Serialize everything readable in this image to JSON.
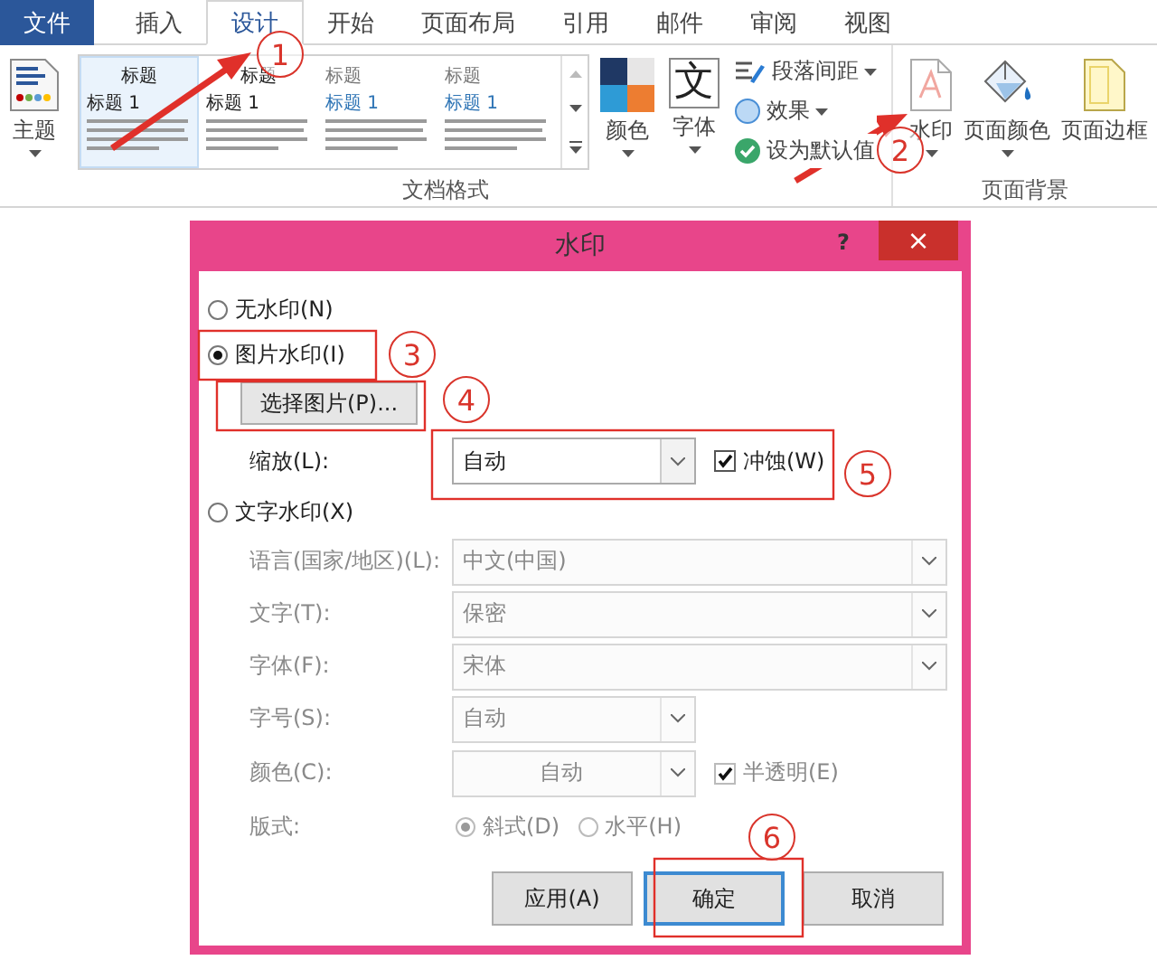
{
  "ribbon": {
    "tabs": [
      {
        "label": "文件",
        "kind": "file",
        "selected": false
      },
      {
        "label": "插入",
        "kind": "tab",
        "selected": false
      },
      {
        "label": "设计",
        "kind": "tab",
        "selected": true
      },
      {
        "label": "开始",
        "kind": "tab",
        "selected": false
      },
      {
        "label": "页面布局",
        "kind": "tab",
        "selected": false
      },
      {
        "label": "引用",
        "kind": "tab",
        "selected": false
      },
      {
        "label": "邮件",
        "kind": "tab",
        "selected": false
      },
      {
        "label": "审阅",
        "kind": "tab",
        "selected": false
      },
      {
        "label": "视图",
        "kind": "tab",
        "selected": false
      }
    ],
    "document_format": {
      "label": "文档格式",
      "theme_button": "主题",
      "gallery": [
        {
          "title": "标题",
          "heading": "标题 1",
          "kind": "centered",
          "selected": true
        },
        {
          "title": "标题",
          "heading": "标题 1",
          "kind": "centered",
          "selected": false
        },
        {
          "title": "标题",
          "heading": "标题 1",
          "kind": "light",
          "selected": false
        },
        {
          "title": "标题",
          "heading": "标题 1",
          "kind": "light",
          "selected": false
        }
      ],
      "colors_button": "颜色",
      "fonts_glyph": "文",
      "fonts_button": "字体",
      "small_buttons": [
        {
          "label": "段落间距",
          "kind": "spacing",
          "dropdown": true
        },
        {
          "label": "效果",
          "kind": "effects",
          "dropdown": true
        },
        {
          "label": "设为默认值",
          "kind": "default",
          "dropdown": false
        }
      ]
    },
    "page_background": {
      "label": "页面背景",
      "buttons": [
        {
          "label": "水印",
          "kind": "watermark",
          "dropdown": true
        },
        {
          "label": "页面颜色",
          "kind": "page-color",
          "dropdown": true
        },
        {
          "label": "页面边框",
          "kind": "page-border",
          "dropdown": false
        }
      ]
    }
  },
  "dialog": {
    "title": "水印",
    "help": "?",
    "close": "×",
    "no_watermark": {
      "label": "无水印(N)",
      "selected": false
    },
    "picture_watermark": {
      "label": "图片水印(I)",
      "selected": true,
      "select_button": "选择图片(P)...",
      "scale_label": "缩放(L):",
      "scale_value": "自动",
      "washout": {
        "label": "冲蚀(W)",
        "checked": true
      }
    },
    "text_watermark": {
      "label": "文字水印(X)",
      "selected": false,
      "disabled": true,
      "fields": [
        {
          "label": "语言(国家/地区)(L):",
          "value": "中文(中国)",
          "kind": "wide"
        },
        {
          "label": "文字(T):",
          "value": "保密",
          "kind": "wide"
        },
        {
          "label": "字体(F):",
          "value": "宋体",
          "kind": "wide"
        },
        {
          "label": "字号(S):",
          "value": "自动",
          "kind": "short"
        },
        {
          "label": "颜色(C):",
          "value": "自动",
          "kind": "color"
        }
      ],
      "semitransparent": {
        "label": "半透明(E)",
        "checked": true
      },
      "layout_label": "版式:",
      "layouts": [
        {
          "label": "斜式(D)",
          "selected": true
        },
        {
          "label": "水平(H)",
          "selected": false
        }
      ]
    },
    "buttons": [
      {
        "label": "应用(A)",
        "default": false
      },
      {
        "label": "确定",
        "default": true
      },
      {
        "label": "取消",
        "default": false
      }
    ]
  },
  "annotations": [
    {
      "label": "1"
    },
    {
      "label": "2"
    },
    {
      "label": "3"
    },
    {
      "label": "4"
    },
    {
      "label": "5"
    },
    {
      "label": "6"
    }
  ]
}
